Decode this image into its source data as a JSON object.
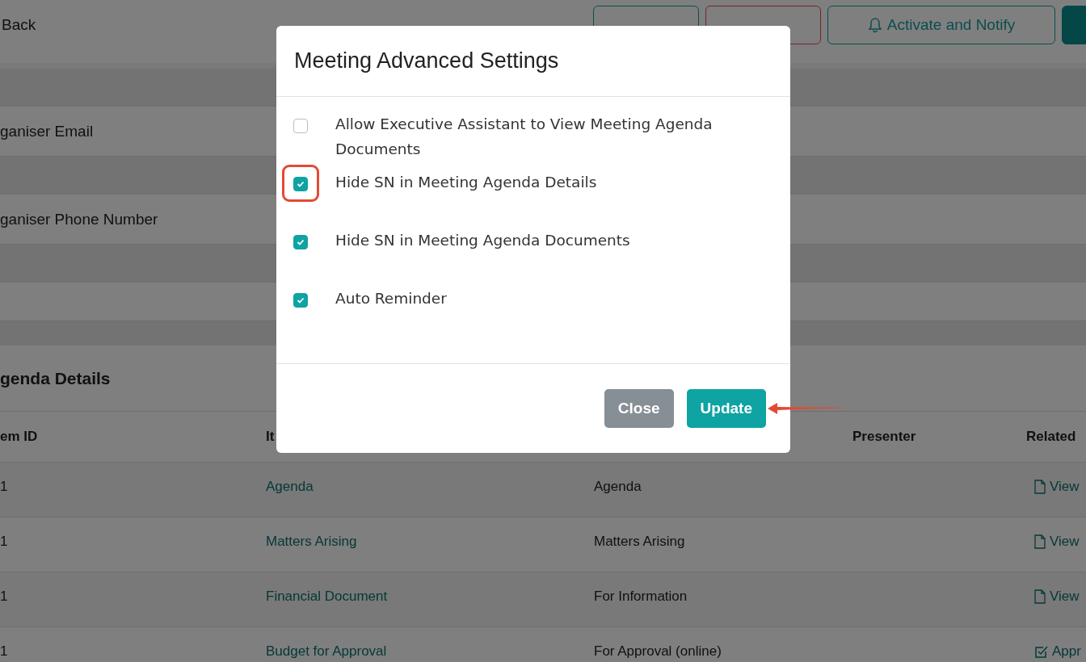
{
  "top_bar": {
    "back": "Back",
    "buttons": [
      {
        "kind": "outline-teal"
      },
      {
        "kind": "outline-red"
      },
      {
        "label": "Activate and Notify",
        "kind": "notify"
      },
      {
        "kind": "filled"
      }
    ]
  },
  "form_rows": [
    {
      "kind": "blank"
    },
    {
      "kind": "field",
      "label": "ganiser Email"
    },
    {
      "kind": "blank"
    },
    {
      "kind": "field",
      "label": "ganiser Phone Number"
    },
    {
      "kind": "blank"
    },
    {
      "kind": "blank"
    }
  ],
  "agenda": {
    "title": "genda Details",
    "columns": [
      "em ID",
      "It",
      "",
      "Presenter",
      "Related"
    ],
    "rows": [
      {
        "id": "1",
        "item": "Agenda",
        "type": "Agenda",
        "doc": {
          "label": "View",
          "kind": "view"
        }
      },
      {
        "id": "1",
        "item": "Matters Arising",
        "type": "Matters Arising",
        "doc": {
          "label": "View",
          "kind": "view"
        }
      },
      {
        "id": "1",
        "item": "Financial Document",
        "type": "For Information",
        "doc": {
          "label": "View",
          "kind": "view"
        }
      },
      {
        "id": "1",
        "item": "Budget for Approval",
        "type": "For Approval (online)",
        "doc": {
          "label": "Appr",
          "kind": "approve"
        }
      }
    ]
  },
  "modal": {
    "title": "Meeting Advanced Settings",
    "options": [
      {
        "label": "Allow Executive Assistant to View Meeting Agenda Documents",
        "checked": false,
        "annotated": false
      },
      {
        "label": "Hide SN in Meeting Agenda Details",
        "checked": true,
        "annotated": true
      },
      {
        "label": "Hide SN in Meeting Agenda Documents",
        "checked": true,
        "annotated": false
      },
      {
        "label": "Auto Reminder",
        "checked": true,
        "annotated": false
      }
    ],
    "buttons": [
      {
        "label": "Close",
        "kind": "secondary",
        "annotated": false
      },
      {
        "label": "Update",
        "kind": "primary",
        "annotated": true
      }
    ]
  }
}
